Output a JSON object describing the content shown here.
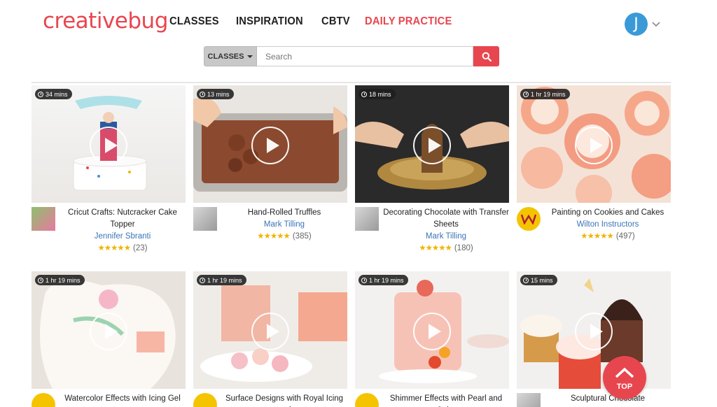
{
  "brand": {
    "logo": "creativebug",
    "accent": "#e8464f"
  },
  "nav": {
    "items": [
      {
        "label": "CLASSES"
      },
      {
        "label": "INSPIRATION"
      },
      {
        "label": "CBTV"
      },
      {
        "label": "DAILY PRACTICE"
      }
    ]
  },
  "user": {
    "initial": "J"
  },
  "search": {
    "category": "CLASSES",
    "placeholder": "Search"
  },
  "classes": [
    {
      "duration": "34 mins",
      "title": "Cricut Crafts: Nutcracker Cake Topper",
      "instructor": "Jennifer Sbranti",
      "stars": "★★★★★",
      "count": "(23)"
    },
    {
      "duration": "13 mins",
      "title": "Hand-Rolled Truffles",
      "instructor": "Mark Tilling",
      "stars": "★★★★★",
      "count": "(385)"
    },
    {
      "duration": "18 mins",
      "title": "Decorating Chocolate with Transfer Sheets",
      "instructor": "Mark Tilling",
      "stars": "★★★★★",
      "count": "(180)"
    },
    {
      "duration": "1 hr 19 mins",
      "title": "Painting on Cookies and Cakes",
      "instructor": "Wilton Instructors",
      "stars": "★★★★★",
      "count": "(497)"
    },
    {
      "duration": "1 hr 19 mins",
      "title": "Watercolor Effects with Icing Gel",
      "instructor": "",
      "stars": "",
      "count": ""
    },
    {
      "duration": "1 hr 19 mins",
      "title": "Surface Designs with Royal Icing and",
      "instructor": "",
      "stars": "",
      "count": ""
    },
    {
      "duration": "1 hr 19 mins",
      "title": "Shimmer Effects with Pearl and Color",
      "instructor": "",
      "stars": "",
      "count": ""
    },
    {
      "duration": "15 mins",
      "title": "Sculptural Chocolate",
      "instructor": "",
      "stars": "",
      "count": ""
    }
  ],
  "top_button": {
    "label": "TOP"
  }
}
